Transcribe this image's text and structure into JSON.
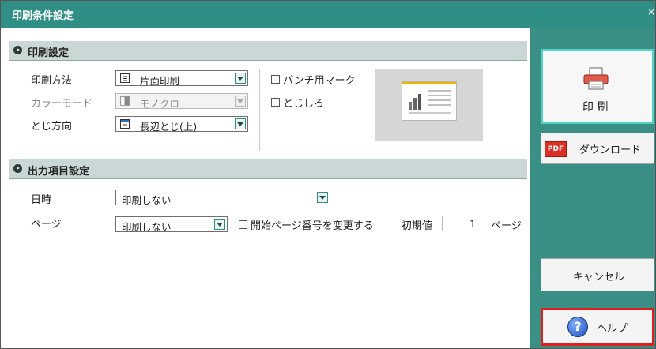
{
  "window": {
    "title": "印刷条件設定",
    "close_label": "×"
  },
  "print_settings": {
    "header": "印刷設定",
    "method": {
      "label": "印刷方法",
      "value": "片面印刷"
    },
    "color_mode": {
      "label": "カラーモード",
      "value": "モノクロ"
    },
    "binding": {
      "label": "とじ方向",
      "value": "長辺とじ(上)"
    },
    "punch_mark": {
      "label": "パンチ用マーク",
      "checked": false
    },
    "binding_margin": {
      "label": "とじしろ",
      "checked": false
    }
  },
  "output_settings": {
    "header": "出力項目設定",
    "datetime": {
      "label": "日時",
      "value": "印刷しない"
    },
    "page": {
      "label": "ページ",
      "value": "印刷しない"
    },
    "change_start_page": {
      "label": "開始ページ番号を変更する",
      "checked": false
    },
    "initial_value": {
      "label": "初期値",
      "value": "1",
      "unit": "ページ"
    }
  },
  "buttons": {
    "print": "印 刷",
    "download": "ダウンロード",
    "pdf_badge": "PDF",
    "cancel": "キャンセル",
    "help": "ヘルプ",
    "help_glyph": "?"
  },
  "icons": {
    "print": "printer-icon",
    "download": "pdf-icon",
    "help": "help-icon",
    "section": "section-bullet-icon"
  },
  "colors": {
    "titlebar": "#2f8f84",
    "side_panel": "#3a9084",
    "section_header": "#c9d8d6",
    "help_highlight": "#e0201d",
    "print_border": "#4fd4c6"
  }
}
